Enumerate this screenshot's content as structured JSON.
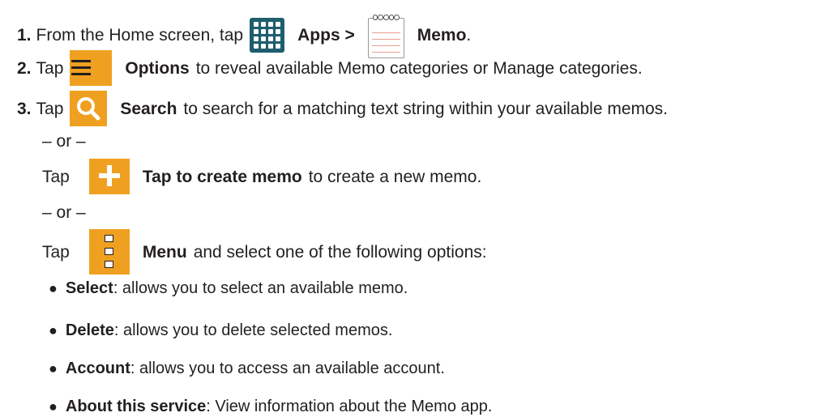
{
  "steps": [
    {
      "number": "1.",
      "text_before": "From the Home screen, tap",
      "apps_label": "Apps >",
      "memo_label": "Memo",
      "text_after": "."
    },
    {
      "number": "2.",
      "text_before": "Tap",
      "options_label": "Options",
      "text_after": "to reveal available Memo categories or Manage categories."
    },
    {
      "number": "3.",
      "text_before": "Tap",
      "search_label": "Search",
      "text_after": "to search for a matching text string within your available memos."
    }
  ],
  "or_separator": "– or –",
  "create": {
    "text_before": "Tap",
    "label": "Tap to create memo",
    "text_after": "to create a new memo."
  },
  "menu": {
    "text_before": "Tap",
    "label": "Menu",
    "text_after": "and select one of the following options:"
  },
  "menu_options": [
    {
      "term": "Select",
      "description": ": allows you to select an available memo."
    },
    {
      "term": "Delete",
      "description": ": allows you to delete selected memos."
    },
    {
      "term": "Account",
      "description": ": allows you to access an available account."
    },
    {
      "term": "About this service",
      "description": ": View information about the Memo app."
    }
  ],
  "icons": {
    "apps": "apps-grid-icon",
    "memo": "memo-notepad-icon",
    "options": "options-menu-icon",
    "search": "search-icon",
    "create": "plus-icon",
    "menu": "more-vertical-icon"
  },
  "colors": {
    "accent_orange": "#f0a020",
    "apps_teal": "#1f5e6e",
    "text": "#231f20"
  }
}
